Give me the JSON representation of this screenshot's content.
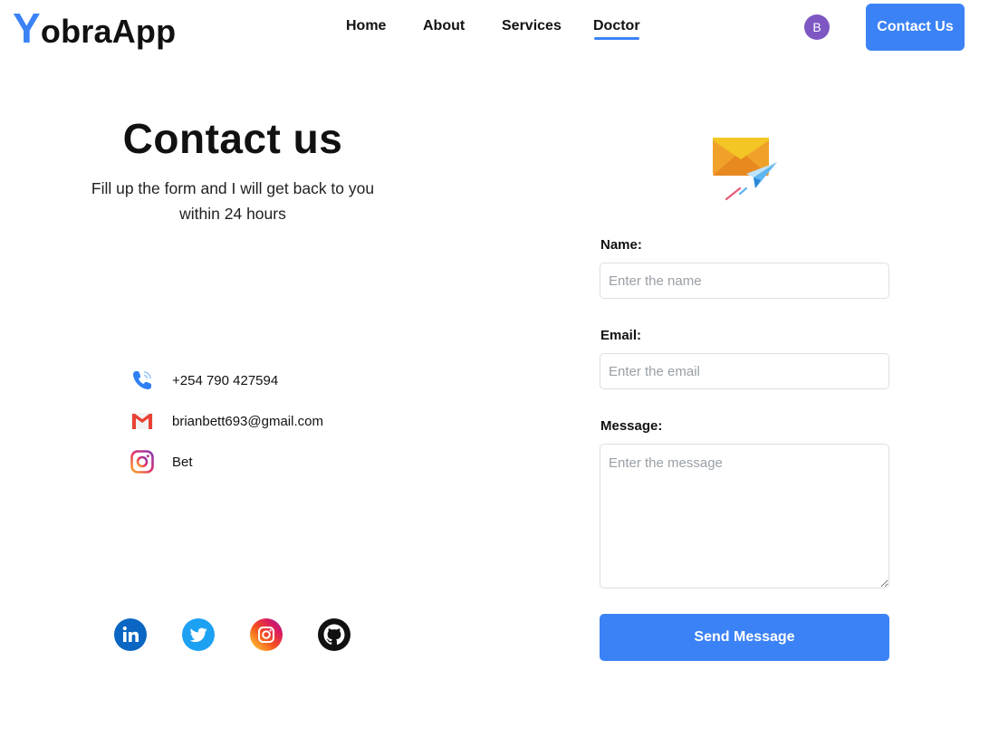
{
  "header": {
    "logo_first": "Y",
    "logo_rest": "obraApp",
    "nav": [
      {
        "label": "Home"
      },
      {
        "label": "About"
      },
      {
        "label": "Services"
      },
      {
        "label": "Doctor",
        "active": true
      }
    ],
    "avatar_initial": "B",
    "contact_button": "Contact Us"
  },
  "intro": {
    "title": "Contact us",
    "subtitle": "Fill up the form and I will get back to you within 24 hours"
  },
  "contact_info": [
    {
      "icon": "phone-icon",
      "text": "+254 790 427594"
    },
    {
      "icon": "gmail-icon",
      "text": "brianbett693@gmail.com"
    },
    {
      "icon": "instagram-icon",
      "text": "Bet"
    }
  ],
  "socials": [
    "linkedin-icon",
    "twitter-icon",
    "instagram-icon",
    "github-icon"
  ],
  "form": {
    "name_label": "Name:",
    "name_placeholder": "Enter the name",
    "email_label": "Email:",
    "email_placeholder": "Enter the email",
    "message_label": "Message:",
    "message_placeholder": "Enter the message",
    "submit_label": "Send Message"
  },
  "colors": {
    "accent": "#3b82f6",
    "avatar": "#7e57c2"
  }
}
